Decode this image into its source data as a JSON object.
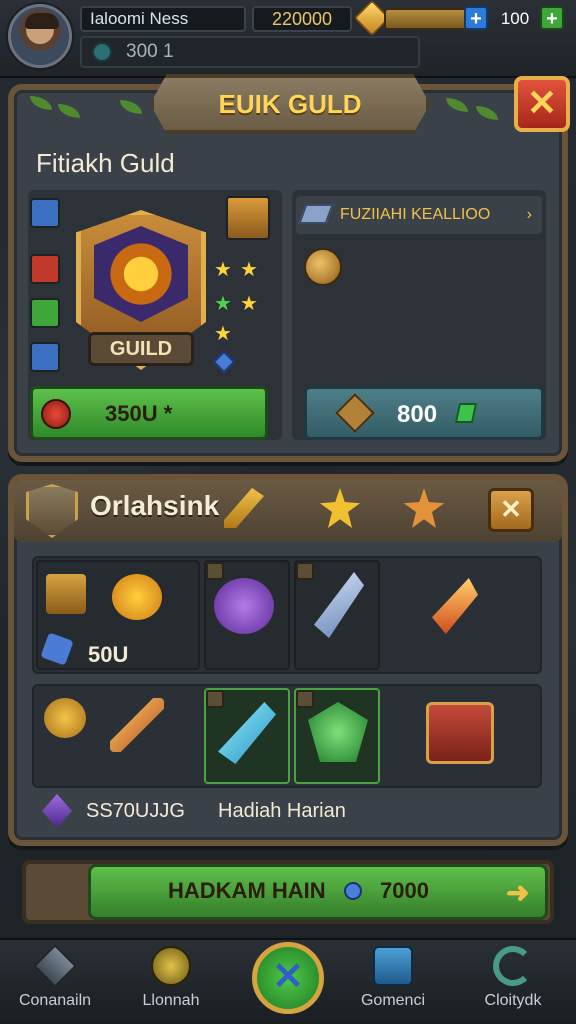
{
  "topbar": {
    "player_name": "Ialoomi Ness",
    "gold": "220000",
    "lives": "100",
    "sub_value": "300 1"
  },
  "guild_panel": {
    "header": "EUIK GULD",
    "title": "Fitiakh Guld",
    "emblem_label": "GUILD",
    "info_text": "FUZIIAHI KEALLIOO",
    "left_button": "350U *",
    "right_button": "800"
  },
  "rewards_panel": {
    "title": "Orlahsink",
    "first_value": "50U",
    "footer_value": "SS70UJJG",
    "footer_label": "Hadiah Harian"
  },
  "claim": {
    "label": "HADKAM HAIN",
    "value": "7000"
  },
  "nav": {
    "items": [
      {
        "label": "Conanailn",
        "icon": "cube-icon"
      },
      {
        "label": "Llonnah",
        "icon": "coin-icon"
      },
      {
        "label": "Gomenci",
        "icon": "chest-icon"
      },
      {
        "label": "Cloitydk",
        "icon": "refresh-icon"
      }
    ]
  },
  "colors": {
    "accent_gold": "#ffd65a",
    "button_green": "#4fa83e",
    "close_red": "#c93a26",
    "panel_wood": "#6b5438"
  }
}
